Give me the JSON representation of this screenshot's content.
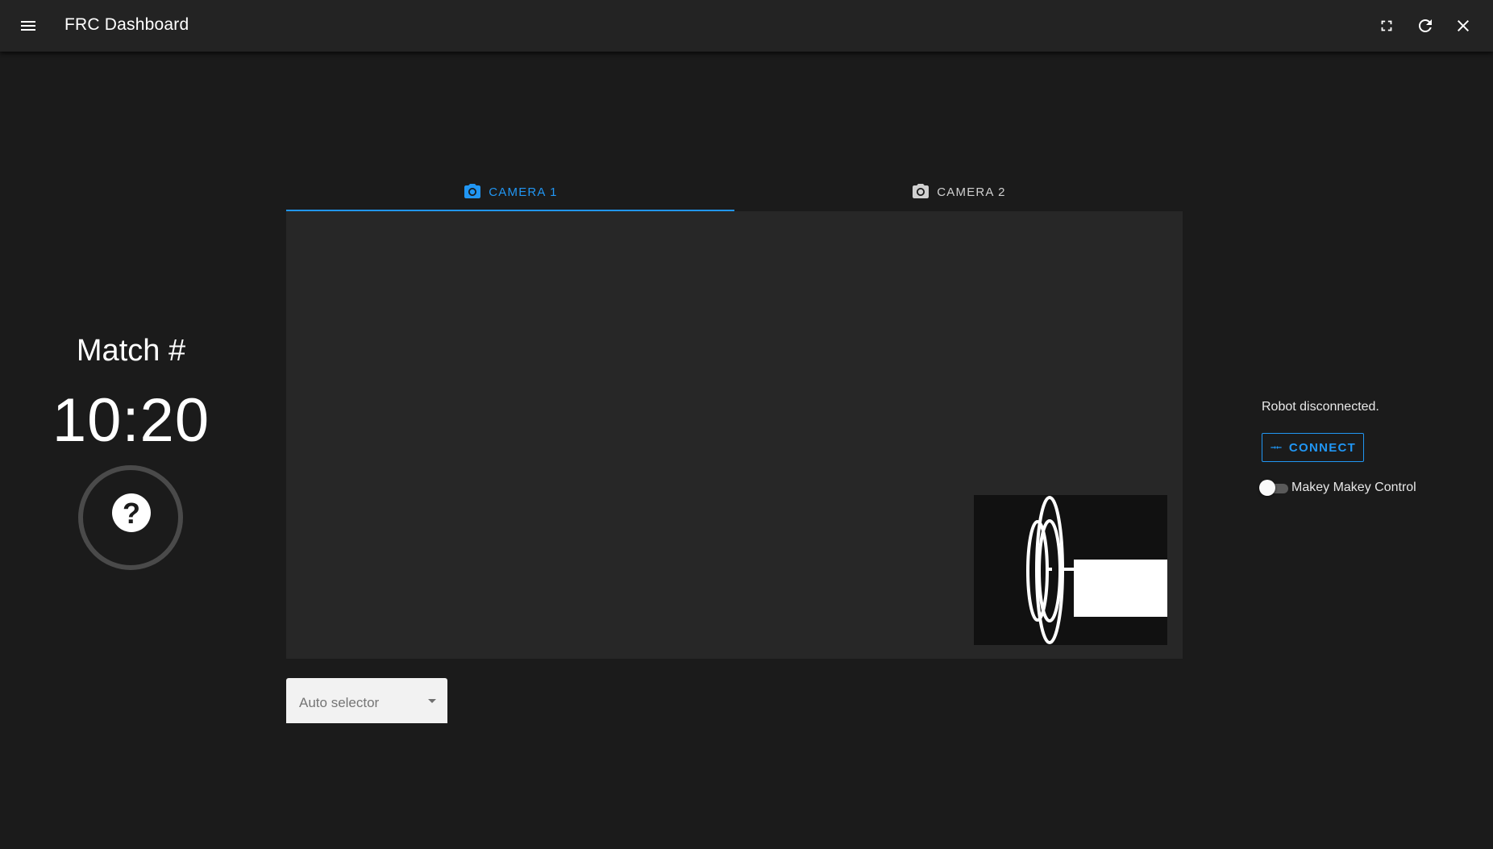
{
  "app": {
    "title": "FRC Dashboard"
  },
  "toolbar": {
    "menu_icon": "menu-icon",
    "fullscreen_icon": "fullscreen-icon",
    "reload_icon": "reload-icon",
    "close_icon": "close-icon"
  },
  "match": {
    "label": "Match #",
    "time": "10:20",
    "status_icon": "help-icon"
  },
  "tabs": [
    {
      "label": "CAMERA 1",
      "icon": "camera-icon",
      "active": true
    },
    {
      "label": "CAMERA 2",
      "icon": "camera-icon",
      "active": false
    }
  ],
  "auto_selector": {
    "placeholder": "Auto selector"
  },
  "robot": {
    "status": "Robot disconnected.",
    "connect_label": "CONNECT",
    "connect_icon": "connect-icon",
    "control_toggle_label": "Makey Makey Control",
    "control_toggle_on": false
  },
  "colors": {
    "accent": "#2196f3",
    "background": "#1b1b1b",
    "appbar": "#232323",
    "camera_panel": "#272727"
  }
}
